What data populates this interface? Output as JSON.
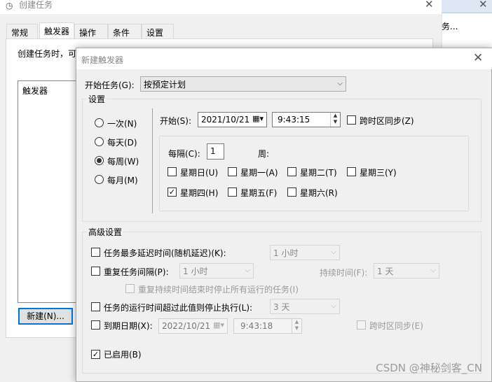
{
  "background_window": {
    "title": "创建任务",
    "tabs": [
      "常规",
      "触发器",
      "操作",
      "条件",
      "设置"
    ],
    "description": "创建任务时，可",
    "list_header": "触发器",
    "new_button": "新建(N)...",
    "right_strip_text": "务..."
  },
  "dialog": {
    "title": "新建触发器",
    "begin_task_label": "开始任务(G):",
    "begin_task_value": "按预定计划",
    "settings": {
      "title": "设置",
      "radios": [
        {
          "label": "一次(N)",
          "checked": false
        },
        {
          "label": "每天(D)",
          "checked": false
        },
        {
          "label": "每周(W)",
          "checked": true
        },
        {
          "label": "每月(M)",
          "checked": false
        }
      ],
      "start_label": "开始(S):",
      "start_date": "2021/10/21",
      "start_time": "9:43:15",
      "sync_tz_label": "跨时区同步(Z)",
      "recur_label": "每隔(C):",
      "recur_value": "1",
      "week_unit": "周:",
      "days": [
        {
          "label": "星期日(U)",
          "checked": false
        },
        {
          "label": "星期一(A)",
          "checked": false
        },
        {
          "label": "星期二(T)",
          "checked": false
        },
        {
          "label": "星期三(Y)",
          "checked": false
        },
        {
          "label": "星期四(H)",
          "checked": true
        },
        {
          "label": "星期五(F)",
          "checked": false
        },
        {
          "label": "星期六(R)",
          "checked": false
        }
      ]
    },
    "advanced": {
      "title": "高级设置",
      "delay_label": "任务最多延迟时间(随机延迟)(K):",
      "delay_value": "1 小时",
      "repeat_label": "重复任务间隔(P):",
      "repeat_value": "1 小时",
      "duration_label": "持续时间(F):",
      "duration_value": "1 天",
      "stop_running_label": "重复持续时间结束时停止所有运行的任务(I)",
      "stop_longer_label": "任务的运行时间超过此值则停止执行(L):",
      "stop_longer_value": "3 天",
      "expire_label": "到期日期(X):",
      "expire_date": "2022/10/21",
      "expire_time": "9:43:18",
      "expire_sync_label": "跨时区同步(E)",
      "enabled_label": "已启用(B)",
      "enabled_checked": true
    }
  },
  "watermark": "CSDN @神秘剑客_CN"
}
